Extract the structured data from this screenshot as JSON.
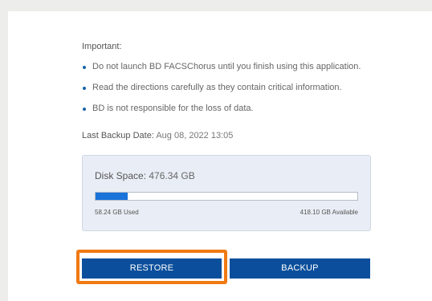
{
  "important": {
    "title": "Important:",
    "items": [
      "Do not launch BD FACSChorus until you finish using this application.",
      "Read the directions carefully as they contain critical information.",
      "BD is not responsible for the loss of data."
    ]
  },
  "backup": {
    "label": "Last Backup Date:",
    "date": "Aug 08, 2022 13:05"
  },
  "disk": {
    "label": "Disk Space:",
    "total": "476.34 GB",
    "used_text": "58.24 GB  Used",
    "available_text": "418.10 GB  Available",
    "used_fraction": 0.1223
  },
  "buttons": {
    "restore": "RESTORE",
    "backup": "BACKUP"
  },
  "colors": {
    "button": "#0b4f9c",
    "progress_fill": "#1a73d9",
    "highlight": "#f07a12",
    "bullet": "#1a63a8"
  }
}
